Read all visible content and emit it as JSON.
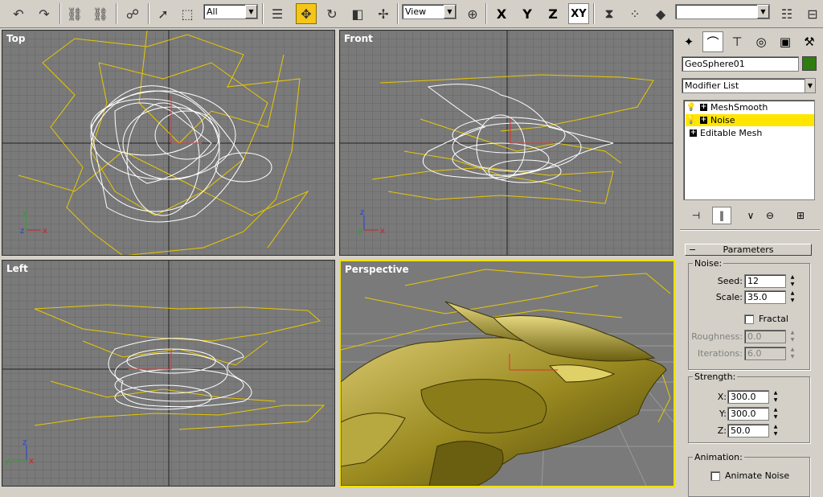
{
  "toolbar": {
    "selection_filter": "All",
    "ref_coord": "View",
    "axis_x": "X",
    "axis_y": "Y",
    "axis_z": "Z",
    "axis_xy": "XY",
    "named_selection": ""
  },
  "viewports": {
    "top": "Top",
    "front": "Front",
    "left": "Left",
    "perspective": "Perspective"
  },
  "panel": {
    "object_name": "GeoSphere01",
    "object_color": "#2e7d10",
    "modifier_list": "Modifier List",
    "stack": [
      {
        "label": "MeshSmooth",
        "selected": false,
        "bulb": true
      },
      {
        "label": "Noise",
        "selected": true,
        "bulb": true
      },
      {
        "label": "Editable Mesh",
        "selected": false,
        "bulb": false
      }
    ],
    "params": {
      "title": "Parameters",
      "noise_group": "Noise:",
      "seed_label": "Seed:",
      "seed": "12",
      "scale_label": "Scale:",
      "scale": "35.0",
      "fractal": "Fractal",
      "roughness_label": "Roughness:",
      "roughness": "0.0",
      "iterations_label": "Iterations:",
      "iterations": "6.0",
      "strength_group": "Strength:",
      "x_label": "X:",
      "x": "300.0",
      "y_label": "Y:",
      "y": "300.0",
      "z_label": "Z:",
      "z": "50.0",
      "animation_group": "Animation:",
      "animate_noise": "Animate Noise"
    }
  },
  "colors": {
    "viewport_bg": "#7a7a7a",
    "active_border": "#f0e000",
    "selection_yellow": "#ffe600",
    "lattice": "#e8c800"
  }
}
